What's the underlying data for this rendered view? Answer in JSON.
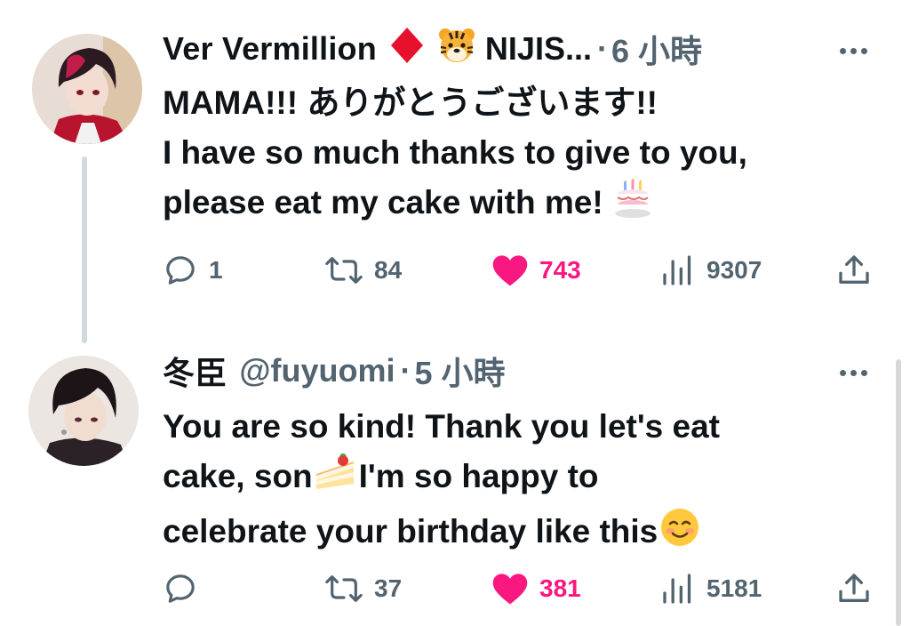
{
  "tweets": [
    {
      "author_name": "Ver Vermillion",
      "author_suffix": "NIJIS...",
      "time_separator": "·",
      "time": "6 小時",
      "name_emojis": [
        "red-diamond",
        "tiger-face"
      ],
      "body_lines": [
        "MAMA!!! ありがとうございます!!",
        "I have so much thanks to give to you,",
        "please eat my cake with me!"
      ],
      "body_trailing_emoji": "birthday-cake",
      "replies": "1",
      "retweets": "84",
      "likes": "743",
      "views": "9307"
    },
    {
      "author_name": "冬臣",
      "handle": "@fuyuomi",
      "time_separator": "·",
      "time": "5 小時",
      "body_lines": [
        "You are so kind! Thank you let's eat",
        "I'm so happy to",
        "celebrate your birthday like this"
      ],
      "body_line2_prefix": "cake, son",
      "body_inline_emojis": [
        "shortcake",
        "smiling-face"
      ],
      "replies": "",
      "retweets": "37",
      "likes": "381",
      "views": "5181"
    }
  ],
  "colors": {
    "text": "#0f1419",
    "secondary": "#536471",
    "like_active": "#f91880",
    "thread_line": "#cfd9de"
  }
}
